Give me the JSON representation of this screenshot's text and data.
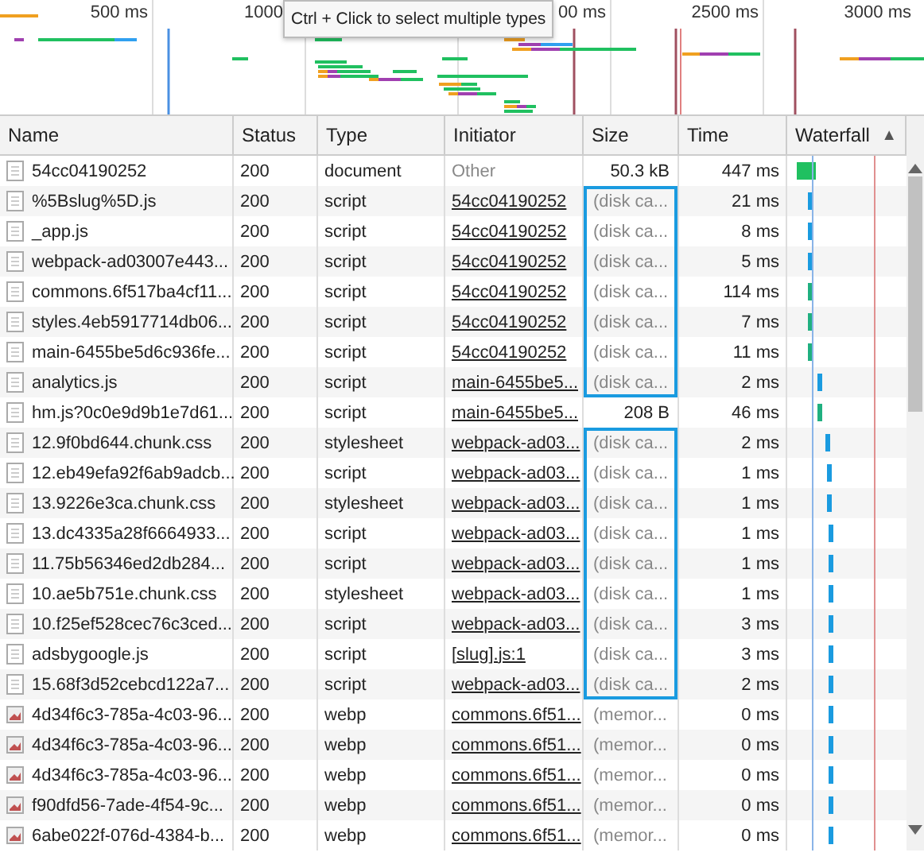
{
  "overview": {
    "ticks": [
      {
        "label": "500 ms"
      },
      {
        "label": "1000"
      },
      {
        "label": "00 ms"
      },
      {
        "label": "2500 ms"
      },
      {
        "label": "3000 ms"
      }
    ],
    "tooltip": "Ctrl + Click to select multiple types"
  },
  "table": {
    "columns": [
      {
        "label": "Name"
      },
      {
        "label": "Status"
      },
      {
        "label": "Type"
      },
      {
        "label": "Initiator"
      },
      {
        "label": "Size"
      },
      {
        "label": "Time"
      },
      {
        "label": "Waterfall",
        "sort_indicator": "▲"
      }
    ],
    "rows": [
      {
        "name": "54cc04190252",
        "kind": "file",
        "status": "200",
        "type": "document",
        "initiator": "Other",
        "initiator_link": false,
        "size": "50.3 kB",
        "from_cache": false,
        "size_boxed": false,
        "time": "447 ms"
      },
      {
        "name": "%5Bslug%5D.js",
        "kind": "file",
        "status": "200",
        "type": "script",
        "initiator": "54cc04190252",
        "initiator_link": true,
        "size": "(disk ca...",
        "from_cache": true,
        "size_boxed": true,
        "time": "21 ms"
      },
      {
        "name": "_app.js",
        "kind": "file",
        "status": "200",
        "type": "script",
        "initiator": "54cc04190252",
        "initiator_link": true,
        "size": "(disk ca...",
        "from_cache": true,
        "size_boxed": true,
        "time": "8 ms"
      },
      {
        "name": "webpack-ad03007e443...",
        "kind": "file",
        "status": "200",
        "type": "script",
        "initiator": "54cc04190252",
        "initiator_link": true,
        "size": "(disk ca...",
        "from_cache": true,
        "size_boxed": true,
        "time": "5 ms"
      },
      {
        "name": "commons.6f517ba4cf11...",
        "kind": "file",
        "status": "200",
        "type": "script",
        "initiator": "54cc04190252",
        "initiator_link": true,
        "size": "(disk ca...",
        "from_cache": true,
        "size_boxed": true,
        "time": "114 ms"
      },
      {
        "name": "styles.4eb5917714db06...",
        "kind": "file",
        "status": "200",
        "type": "script",
        "initiator": "54cc04190252",
        "initiator_link": true,
        "size": "(disk ca...",
        "from_cache": true,
        "size_boxed": true,
        "time": "7 ms"
      },
      {
        "name": "main-6455be5d6c936fe...",
        "kind": "file",
        "status": "200",
        "type": "script",
        "initiator": "54cc04190252",
        "initiator_link": true,
        "size": "(disk ca...",
        "from_cache": true,
        "size_boxed": true,
        "time": "11 ms"
      },
      {
        "name": "analytics.js",
        "kind": "file",
        "status": "200",
        "type": "script",
        "initiator": "main-6455be5...",
        "initiator_link": true,
        "size": "(disk ca...",
        "from_cache": true,
        "size_boxed": true,
        "time": "2 ms"
      },
      {
        "name": "hm.js?0c0e9d9b1e7d61...",
        "kind": "file",
        "status": "200",
        "type": "script",
        "initiator": "main-6455be5...",
        "initiator_link": true,
        "size": "208 B",
        "from_cache": false,
        "size_boxed": false,
        "time": "46 ms"
      },
      {
        "name": "12.9f0bd644.chunk.css",
        "kind": "file",
        "status": "200",
        "type": "stylesheet",
        "initiator": "webpack-ad03...",
        "initiator_link": true,
        "size": "(disk ca...",
        "from_cache": true,
        "size_boxed": true,
        "time": "2 ms"
      },
      {
        "name": "12.eb49efa92f6ab9adcb...",
        "kind": "file",
        "status": "200",
        "type": "script",
        "initiator": "webpack-ad03...",
        "initiator_link": true,
        "size": "(disk ca...",
        "from_cache": true,
        "size_boxed": true,
        "time": "1 ms"
      },
      {
        "name": "13.9226e3ca.chunk.css",
        "kind": "file",
        "status": "200",
        "type": "stylesheet",
        "initiator": "webpack-ad03...",
        "initiator_link": true,
        "size": "(disk ca...",
        "from_cache": true,
        "size_boxed": true,
        "time": "1 ms"
      },
      {
        "name": "13.dc4335a28f6664933...",
        "kind": "file",
        "status": "200",
        "type": "script",
        "initiator": "webpack-ad03...",
        "initiator_link": true,
        "size": "(disk ca...",
        "from_cache": true,
        "size_boxed": true,
        "time": "1 ms"
      },
      {
        "name": "11.75b56346ed2db284...",
        "kind": "file",
        "status": "200",
        "type": "script",
        "initiator": "webpack-ad03...",
        "initiator_link": true,
        "size": "(disk ca...",
        "from_cache": true,
        "size_boxed": true,
        "time": "1 ms"
      },
      {
        "name": "10.ae5b751e.chunk.css",
        "kind": "file",
        "status": "200",
        "type": "stylesheet",
        "initiator": "webpack-ad03...",
        "initiator_link": true,
        "size": "(disk ca...",
        "from_cache": true,
        "size_boxed": true,
        "time": "1 ms"
      },
      {
        "name": "10.f25ef528cec76c3ced...",
        "kind": "file",
        "status": "200",
        "type": "script",
        "initiator": "webpack-ad03...",
        "initiator_link": true,
        "size": "(disk ca...",
        "from_cache": true,
        "size_boxed": true,
        "time": "3 ms"
      },
      {
        "name": "adsbygoogle.js",
        "kind": "file",
        "status": "200",
        "type": "script",
        "initiator": "[slug].js:1",
        "initiator_link": true,
        "size": "(disk ca...",
        "from_cache": true,
        "size_boxed": true,
        "time": "3 ms"
      },
      {
        "name": "15.68f3d52cebcd122a7...",
        "kind": "file",
        "status": "200",
        "type": "script",
        "initiator": "webpack-ad03...",
        "initiator_link": true,
        "size": "(disk ca...",
        "from_cache": true,
        "size_boxed": true,
        "time": "2 ms"
      },
      {
        "name": "4d34f6c3-785a-4c03-96...",
        "kind": "image",
        "status": "200",
        "type": "webp",
        "initiator": "commons.6f51...",
        "initiator_link": true,
        "size": "(memor...",
        "from_cache": true,
        "size_boxed": false,
        "time": "0 ms"
      },
      {
        "name": "4d34f6c3-785a-4c03-96...",
        "kind": "image",
        "status": "200",
        "type": "webp",
        "initiator": "commons.6f51...",
        "initiator_link": true,
        "size": "(memor...",
        "from_cache": true,
        "size_boxed": false,
        "time": "0 ms"
      },
      {
        "name": "4d34f6c3-785a-4c03-96...",
        "kind": "image",
        "status": "200",
        "type": "webp",
        "initiator": "commons.6f51...",
        "initiator_link": true,
        "size": "(memor...",
        "from_cache": true,
        "size_boxed": false,
        "time": "0 ms"
      },
      {
        "name": "f90dfd56-7ade-4f54-9c...",
        "kind": "image",
        "status": "200",
        "type": "webp",
        "initiator": "commons.6f51...",
        "initiator_link": true,
        "size": "(memor...",
        "from_cache": true,
        "size_boxed": false,
        "time": "0 ms"
      },
      {
        "name": "6abe022f-076d-4384-b...",
        "kind": "image",
        "status": "200",
        "type": "webp",
        "initiator": "commons.6f51...",
        "initiator_link": true,
        "size": "(memor...",
        "from_cache": true,
        "size_boxed": false,
        "time": "0 ms"
      }
    ]
  }
}
